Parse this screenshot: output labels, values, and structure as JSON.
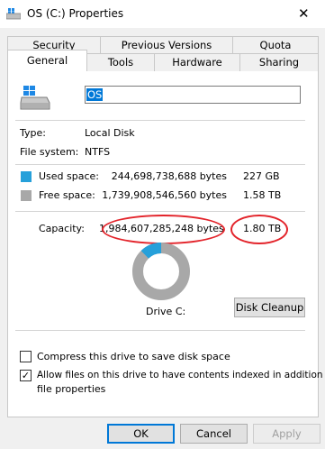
{
  "window": {
    "title": "OS (C:) Properties",
    "close_glyph": "✕"
  },
  "tabs_row1": [
    {
      "label": "Security"
    },
    {
      "label": "Previous Versions"
    },
    {
      "label": "Quota"
    }
  ],
  "tabs_row2": [
    {
      "label": "General"
    },
    {
      "label": "Tools"
    },
    {
      "label": "Hardware"
    },
    {
      "label": "Sharing"
    }
  ],
  "general": {
    "drive_name": "OS",
    "type_label": "Type:",
    "type_value": "Local Disk",
    "fs_label": "File system:",
    "fs_value": "NTFS",
    "used_label": "Used space:",
    "used_bytes": "244,698,738,688 bytes",
    "used_size": "227 GB",
    "free_label": "Free space:",
    "free_bytes": "1,739,908,546,560 bytes",
    "free_size": "1.58 TB",
    "capacity_label": "Capacity:",
    "capacity_bytes": "1,984,607,285,248 bytes",
    "capacity_size": "1.80 TB",
    "drive_caption": "Drive C:",
    "disk_cleanup_label": "Disk Cleanup",
    "used_fraction": 0.123,
    "used_color": "#26a0da",
    "free_color": "#a8a8a8",
    "highlight_color": "#e3242b",
    "compress_label": "Compress this drive to save disk space",
    "compress_checked": false,
    "index_label_line1": "Allow files on this drive to have contents indexed in addition to",
    "index_label_line2": "file properties",
    "index_checked": true
  },
  "buttons": {
    "ok": "OK",
    "cancel": "Cancel",
    "apply": "Apply"
  }
}
